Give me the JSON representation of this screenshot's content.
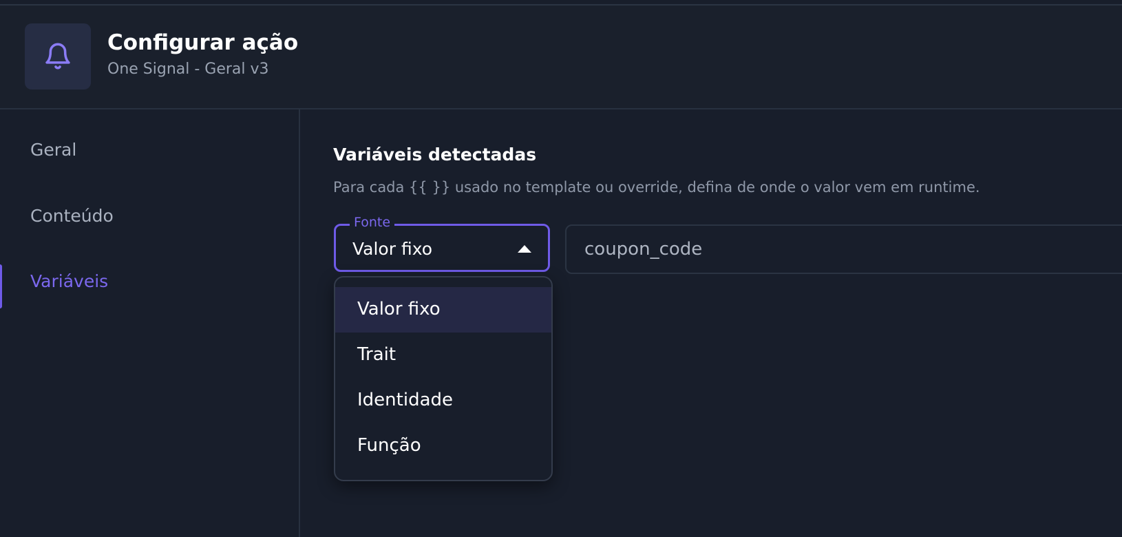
{
  "header": {
    "title": "Configurar ação",
    "subtitle": "One Signal - Geral v3",
    "icon": "bell-icon",
    "icon_color": "#8b7cf6"
  },
  "sidebar": {
    "items": [
      {
        "label": "Geral",
        "active": false
      },
      {
        "label": "Conteúdo",
        "active": false
      },
      {
        "label": "Variáveis",
        "active": true
      }
    ]
  },
  "main": {
    "section_title": "Variáveis detectadas",
    "section_description": "Para cada {{ }} usado no template ou override, defina de onde o valor vem em runtime.",
    "variable": {
      "source_label": "Fonte",
      "source_value": "Valor fixo",
      "name": "coupon_code"
    },
    "dropdown": {
      "open": true,
      "options": [
        "Valor fixo",
        "Trait",
        "Identidade",
        "Função"
      ],
      "selected": "Valor fixo"
    }
  },
  "colors": {
    "background": "#181e2b",
    "accent": "#6f5be8",
    "active_text": "#7b68ee",
    "selected_option_bg": "#252845"
  }
}
